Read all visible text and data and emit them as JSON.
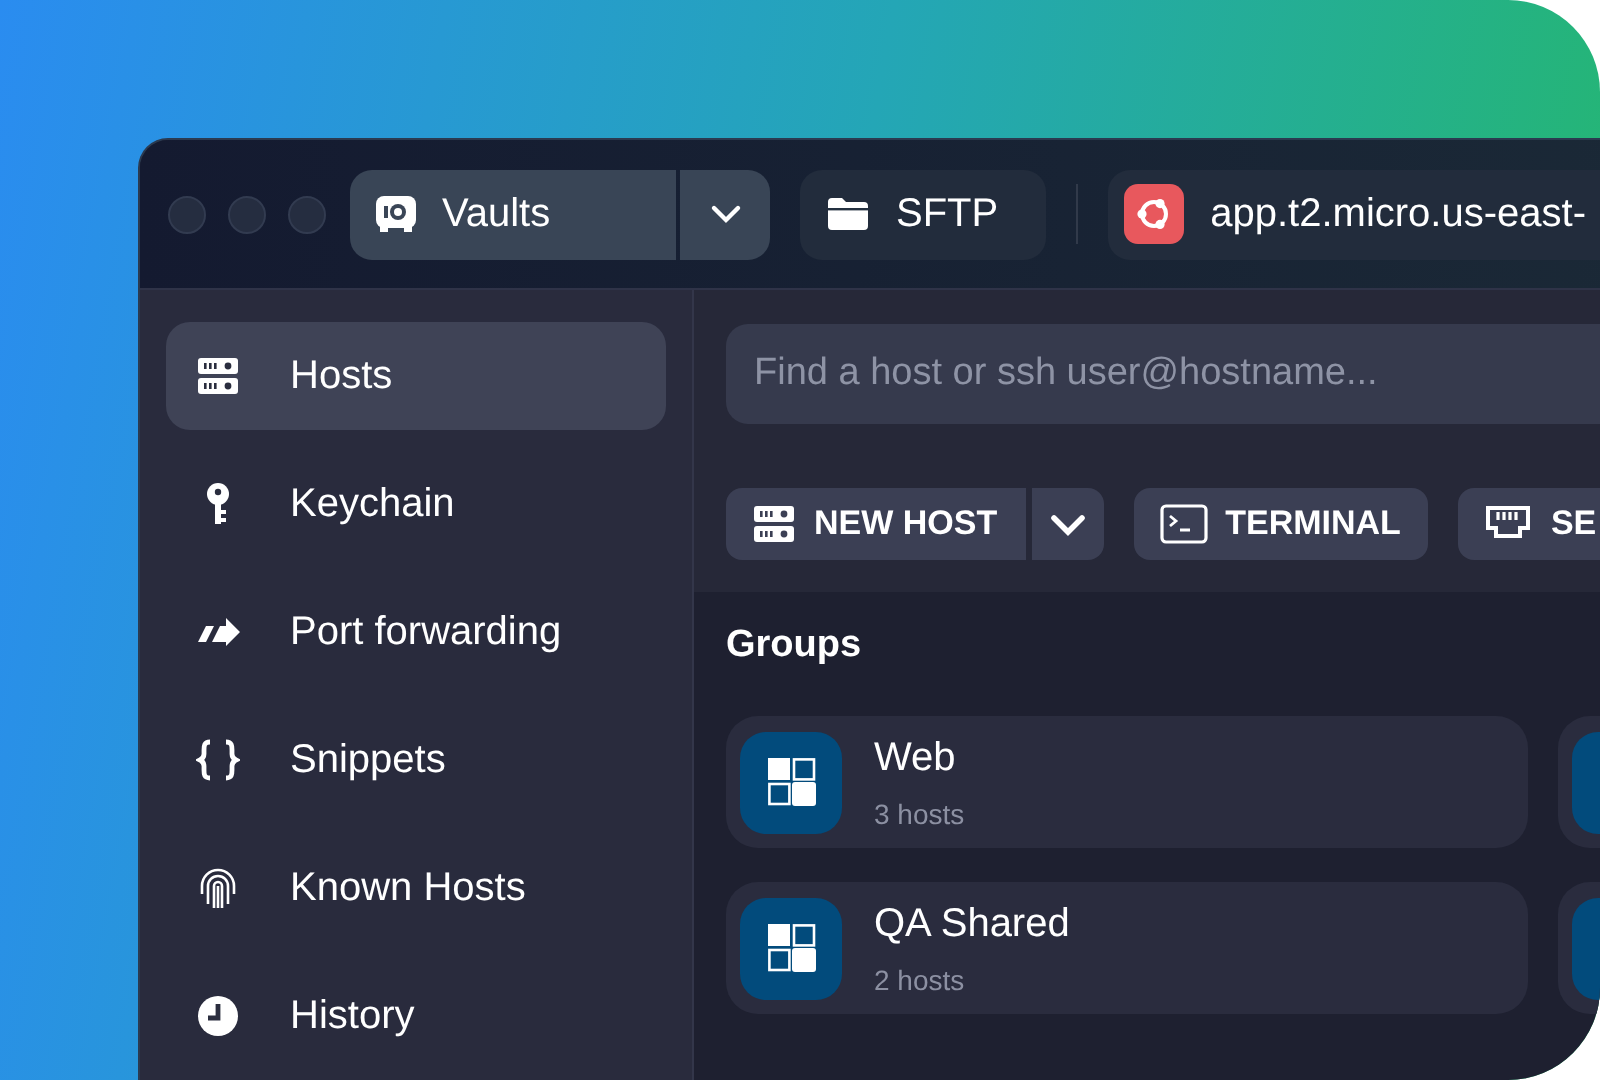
{
  "titlebar": {
    "vault": {
      "label": "Vaults"
    },
    "tabs": [
      {
        "label": "SFTP",
        "kind": "sftp",
        "selected": false
      },
      {
        "label": "app.t2.micro.us-east-",
        "kind": "host",
        "selected": false
      }
    ]
  },
  "sidebar": {
    "items": [
      {
        "label": "Hosts",
        "kind": "server",
        "selected": true
      },
      {
        "label": "Keychain",
        "kind": "key",
        "selected": false
      },
      {
        "label": "Port forwarding",
        "kind": "forward",
        "selected": false
      },
      {
        "label": "Snippets",
        "kind": "braces",
        "selected": false
      },
      {
        "label": "Known Hosts",
        "kind": "fingerprint",
        "selected": false
      },
      {
        "label": "History",
        "kind": "clock",
        "selected": false
      }
    ]
  },
  "search": {
    "placeholder": "Find a host or ssh user@hostname..."
  },
  "toolbar": [
    {
      "label": "NEW HOST",
      "kind": "split"
    },
    {
      "label": "TERMINAL",
      "kind": "terminal"
    },
    {
      "label": "SE",
      "kind": "ethernet"
    }
  ],
  "groups": {
    "title": "Groups",
    "items": [
      {
        "name": "Web",
        "count": "3 hosts"
      },
      {
        "name": "QA Shared",
        "count": "2 hosts"
      }
    ]
  }
}
